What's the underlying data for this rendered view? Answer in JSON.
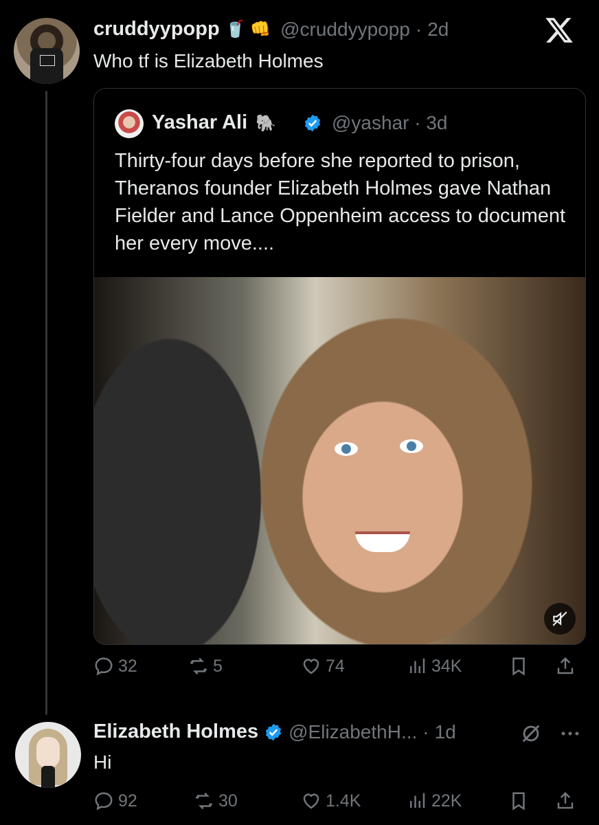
{
  "post1": {
    "display_name": "cruddyypopp",
    "emoji": "🥤 👊",
    "handle": "@cruddyypopp",
    "time": "2d",
    "text": "Who tf is Elizabeth Holmes"
  },
  "quote": {
    "display_name": "Yashar Ali",
    "emoji": "🐘",
    "handle": "@yashar",
    "time": "3d",
    "text": "Thirty-four days before she reported to prison, Theranos founder Elizabeth Holmes gave Nathan Fielder and Lance Oppenheim access to document her every move...."
  },
  "post1_actions": {
    "replies": "32",
    "reposts": "5",
    "likes": "74",
    "views": "34K"
  },
  "post2": {
    "display_name": "Elizabeth Holmes",
    "handle": "@ElizabethH...",
    "time": "1d",
    "text": "Hi"
  },
  "post2_actions": {
    "replies": "92",
    "reposts": "30",
    "likes": "1.4K",
    "views": "22K"
  },
  "colors": {
    "background": "#000000",
    "text": "#e7e9ea",
    "muted": "#71767b",
    "verified": "#1d9bf0",
    "border": "#2f3336"
  }
}
